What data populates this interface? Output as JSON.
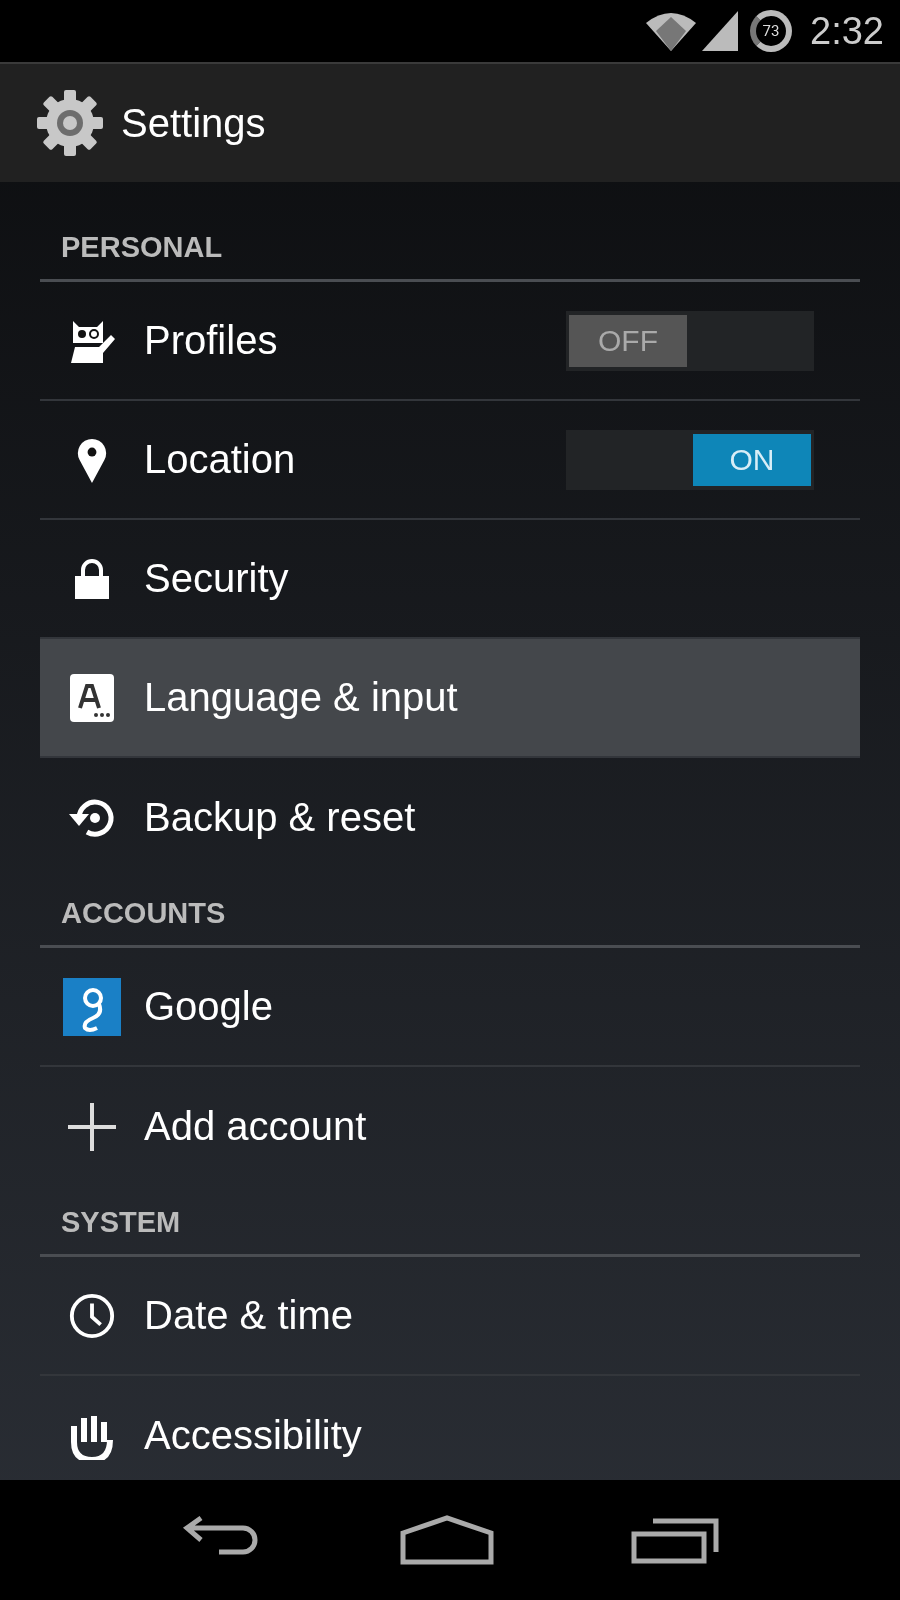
{
  "status_bar": {
    "battery": "73",
    "time": "2:32"
  },
  "action_bar": {
    "title": "Settings"
  },
  "sections": [
    {
      "header": "PERSONAL",
      "items": [
        {
          "label": "Profiles",
          "kind": "toggle",
          "on": false,
          "toggle_text": "OFF",
          "selected": false
        },
        {
          "label": "Location",
          "kind": "toggle",
          "on": true,
          "toggle_text": "ON",
          "selected": false
        },
        {
          "label": "Security",
          "kind": "plain",
          "selected": false
        },
        {
          "label": "Language & input",
          "kind": "plain",
          "selected": true
        },
        {
          "label": "Backup & reset",
          "kind": "plain",
          "selected": false
        }
      ]
    },
    {
      "header": "ACCOUNTS",
      "items": [
        {
          "label": "Google",
          "kind": "plain",
          "selected": false
        },
        {
          "label": "Add account",
          "kind": "plain",
          "selected": false
        }
      ]
    },
    {
      "header": "SYSTEM",
      "items": [
        {
          "label": "Date & time",
          "kind": "plain",
          "selected": false
        },
        {
          "label": "Accessibility",
          "kind": "plain",
          "selected": false
        }
      ]
    }
  ]
}
